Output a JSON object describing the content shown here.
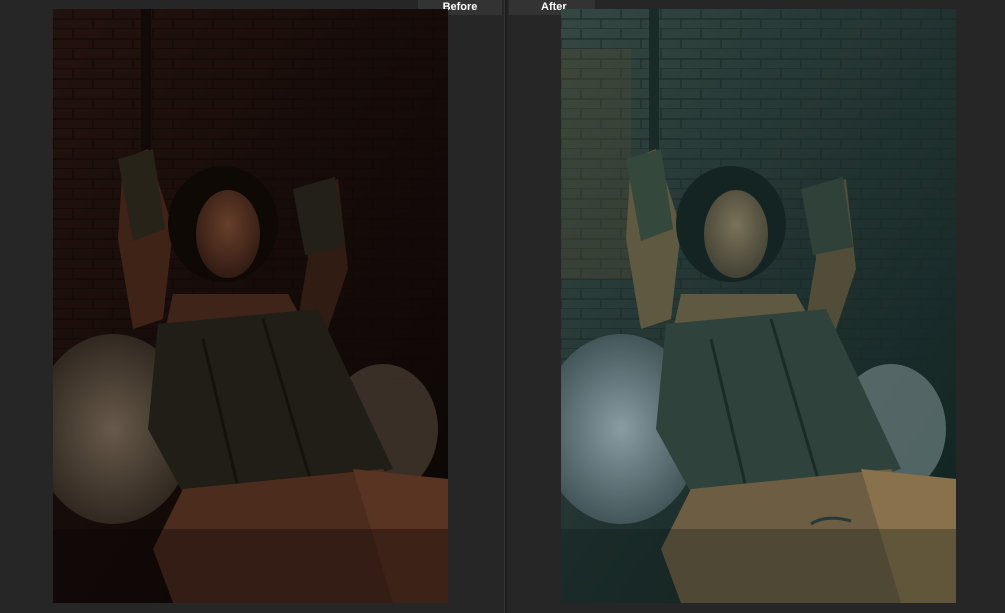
{
  "compare": {
    "before_label": "Before",
    "after_label": "After"
  },
  "colors": {
    "background": "#262626",
    "tab": "#333333",
    "tab_text": "#ffffff"
  },
  "icons": {
    "before_photo": "portrait-photo-original",
    "after_photo": "portrait-photo-color-graded"
  }
}
